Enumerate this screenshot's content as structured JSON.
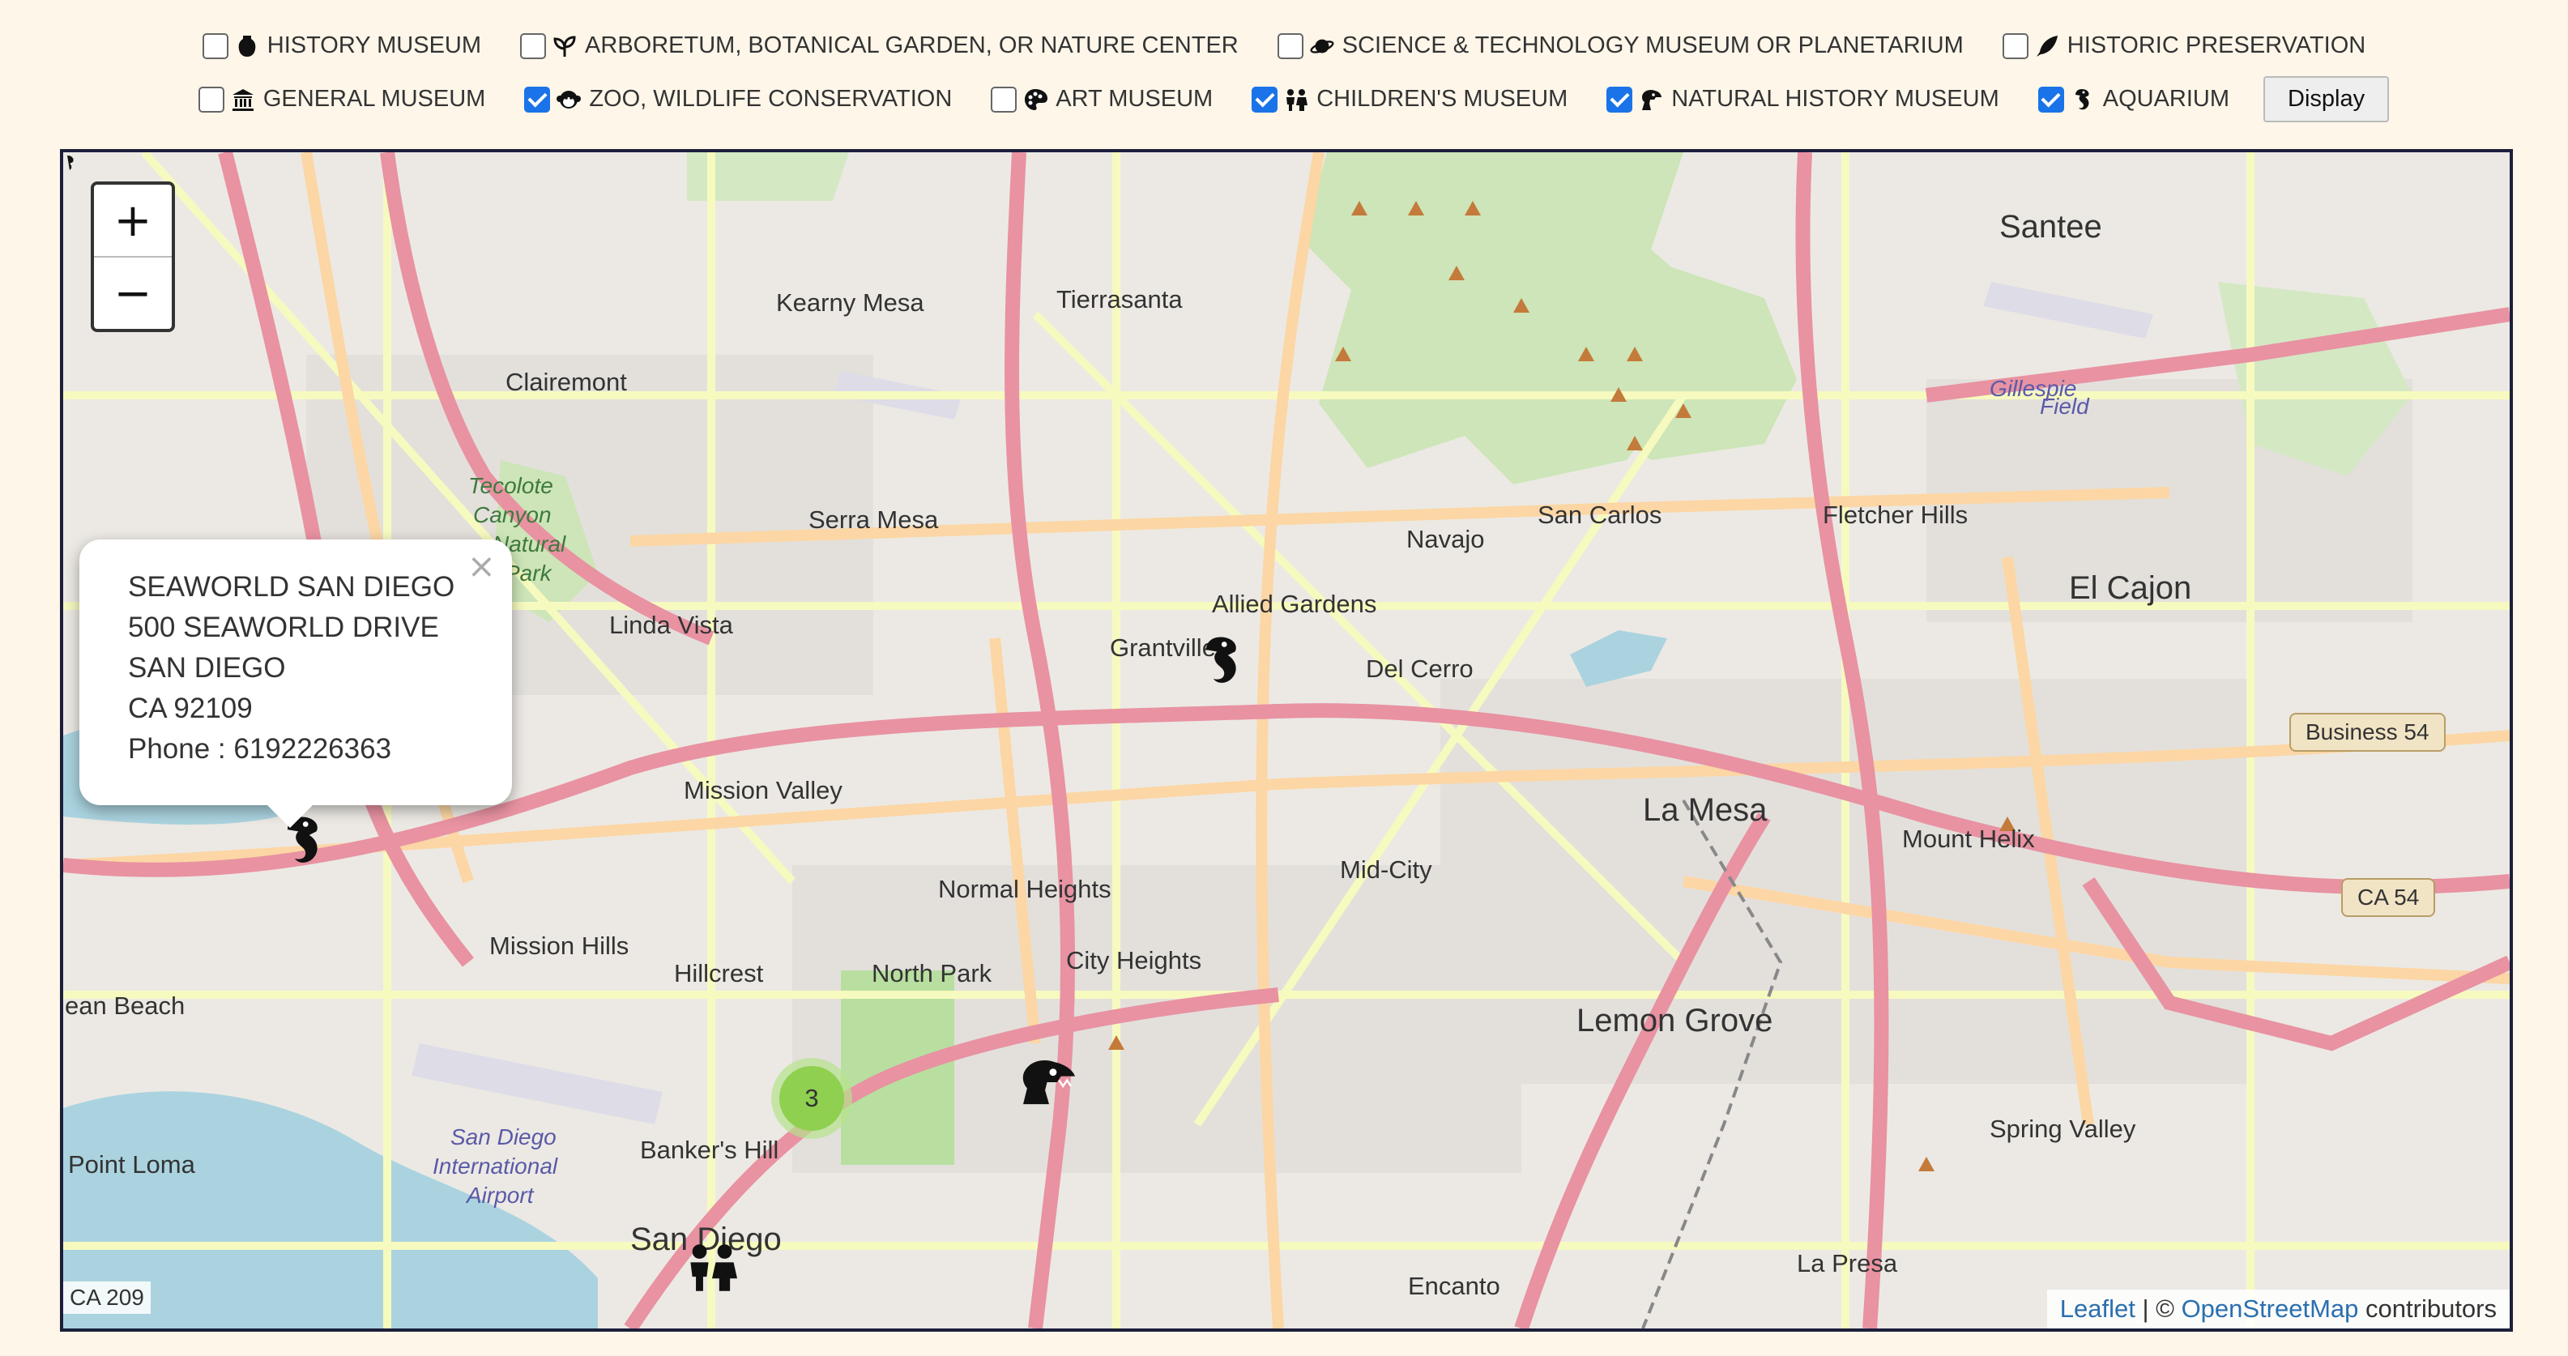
{
  "filters": {
    "row1": [
      {
        "label": "History Museum",
        "checked": false,
        "icon": "vase-icon"
      },
      {
        "label": "Arboretum, Botanical Garden, or Nature Center",
        "checked": false,
        "icon": "leaf-icon"
      },
      {
        "label": "Science & Technology Museum or Planetarium",
        "checked": false,
        "icon": "planet-icon"
      },
      {
        "label": "Historic Preservation",
        "checked": false,
        "icon": "quill-icon"
      }
    ],
    "row2": [
      {
        "label": "General Museum",
        "checked": false,
        "icon": "museum-building-icon"
      },
      {
        "label": "Zoo, Wildlife Conservation",
        "checked": true,
        "icon": "monkey-icon"
      },
      {
        "label": "Art Museum",
        "checked": false,
        "icon": "palette-icon"
      },
      {
        "label": "Children's Museum",
        "checked": true,
        "icon": "children-icon"
      },
      {
        "label": "Natural History Museum",
        "checked": true,
        "icon": "dinosaur-icon"
      },
      {
        "label": "Aquarium",
        "checked": true,
        "icon": "seahorse-icon"
      }
    ],
    "display_label": "Display"
  },
  "map": {
    "zoom_in": "+",
    "zoom_out": "−",
    "popup": {
      "lines": [
        "SEAWORLD SAN DIEGO",
        "500 SEAWORLD DRIVE",
        "SAN DIEGO",
        "CA 92109",
        "Phone : 6192226363"
      ],
      "close": "×"
    },
    "cluster_count": "3",
    "places": {
      "kearny_mesa": "Kearny Mesa",
      "tierrasanta": "Tierrasanta",
      "santee": "Santee",
      "clairemont": "Clairemont",
      "tecolote": "Tecolote",
      "canyon": "Canyon",
      "natural": "Natural",
      "park": "Park",
      "serra_mesa": "Serra Mesa",
      "navajo": "Navajo",
      "san_carlos": "San Carlos",
      "fletcher_hills": "Fletcher Hills",
      "el_cajon": "El Cajon",
      "linda_vista": "Linda Vista",
      "allied_gardens": "Allied Gardens",
      "grantville": "Grantville",
      "del_cerro": "Del Cerro",
      "mission_valley": "Mission Valley",
      "la_mesa": "La Mesa",
      "mount_helix": "Mount Helix",
      "normal_heights": "Normal Heights",
      "mid_city": "Mid-City",
      "mission_hills": "Mission Hills",
      "hillcrest": "Hillcrest",
      "north_park": "North Park",
      "city_heights": "City Heights",
      "ocean_beach": "ean Beach",
      "lemon_grove": "Lemon Grove",
      "bankers_hill": "Banker's Hill",
      "point_loma": "Point Loma",
      "san_diego": "San Diego",
      "san_diego_intl": "San Diego",
      "international": "International",
      "airport": "Airport",
      "spring_valley": "Spring Valley",
      "la_presa": "La Presa",
      "encanto": "Encanto",
      "gillespie": "Gillespie",
      "field": "Field"
    },
    "shields": {
      "business54": "Business 54",
      "ca54": "CA 54",
      "ca209": "CA 209"
    },
    "attribution": {
      "leaflet": "Leaflet",
      "sep": " | © ",
      "osm": "OpenStreetMap",
      "contrib": " contributors"
    },
    "colors": {
      "road_major": "#e892a2",
      "road_secondary": "#fcd6a4",
      "road_minor": "#f7fabf",
      "park": "#add19e",
      "water": "#aad3df",
      "land": "#f2efe9",
      "urban": "#e0dfdf"
    }
  }
}
